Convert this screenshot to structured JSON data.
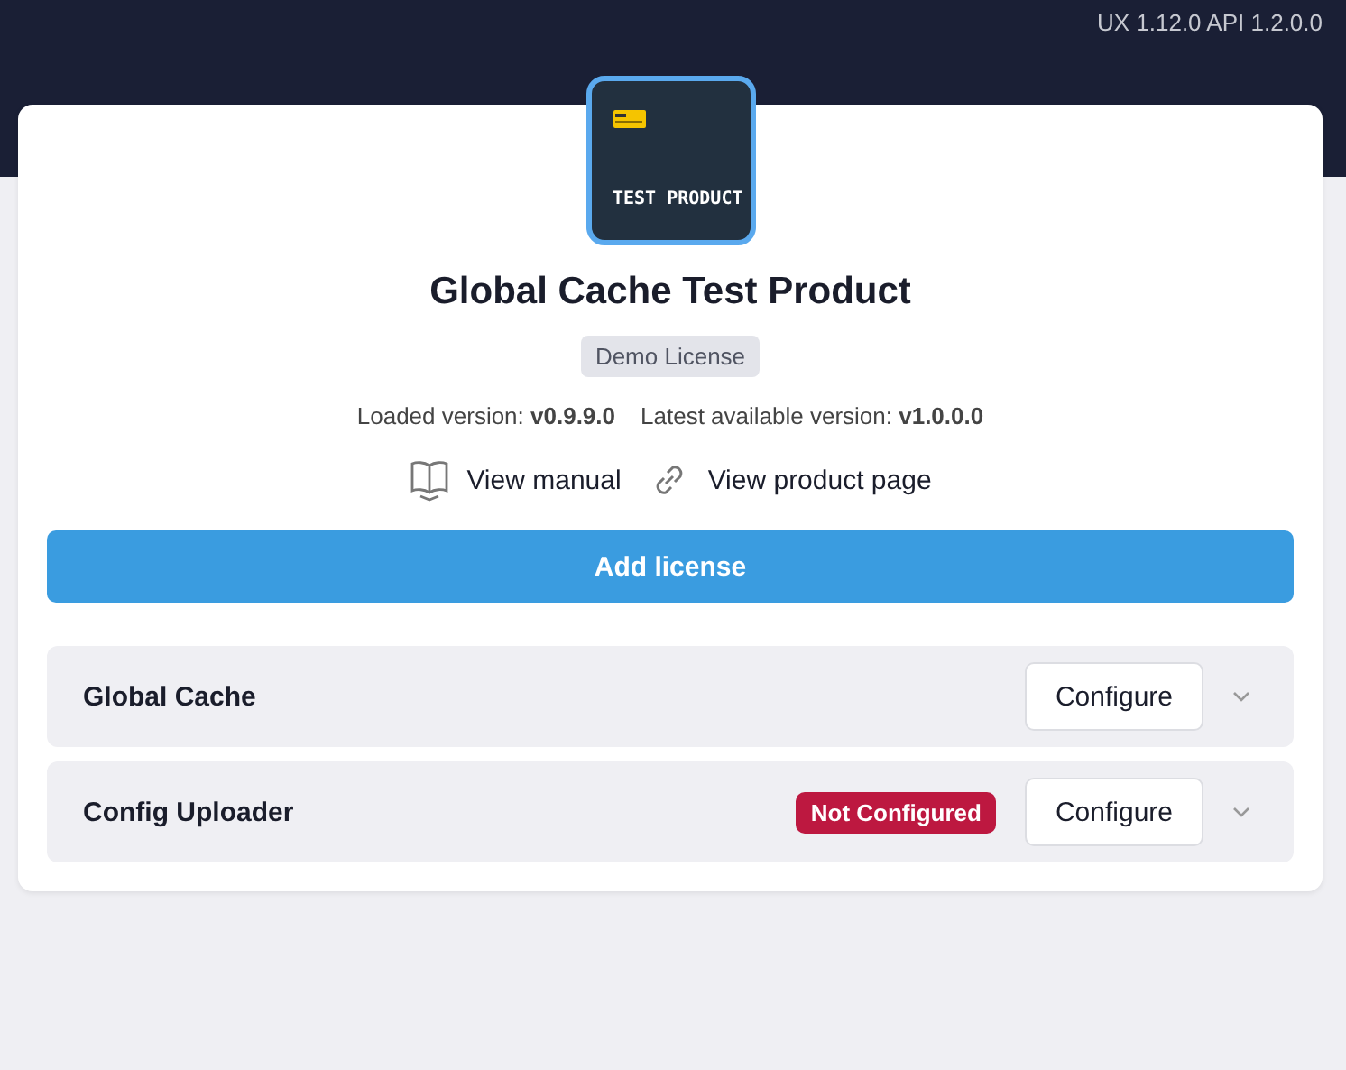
{
  "header": {
    "version_info": "UX 1.12.0 API 1.2.0.0"
  },
  "product": {
    "logo_text": "TEST PRODUCT",
    "title": "Global Cache Test Product",
    "license_badge": "Demo License",
    "loaded_version": "Loaded version: **v0.9.9.0**",
    "latest_version": "Latest available version: **v1.0.0.0**"
  },
  "links": [
    {
      "kind": "manual",
      "label": "View manual"
    },
    {
      "kind": "product",
      "label": "View product page"
    }
  ],
  "add_license_button": "Add license",
  "modules": [
    {
      "name": "Global Cache",
      "button": "Configure",
      "expanded": false
    },
    {
      "name": "Config Uploader",
      "status": "Not Configured",
      "button": "Configure",
      "expanded": false
    }
  ]
}
